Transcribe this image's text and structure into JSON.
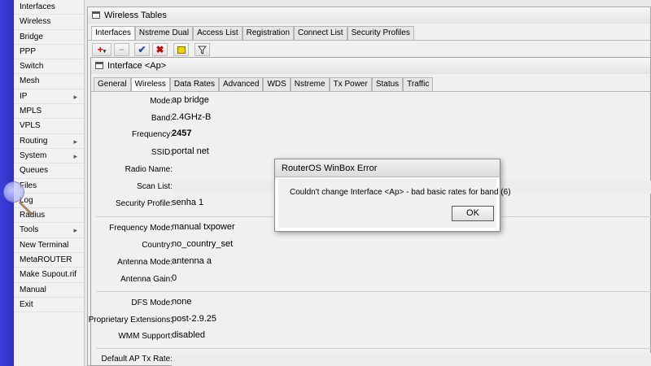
{
  "sidebar": {
    "items": [
      {
        "label": "Interfaces",
        "has_submenu": false
      },
      {
        "label": "Wireless",
        "has_submenu": false
      },
      {
        "label": "Bridge",
        "has_submenu": false
      },
      {
        "label": "PPP",
        "has_submenu": false
      },
      {
        "label": "Switch",
        "has_submenu": false
      },
      {
        "label": "Mesh",
        "has_submenu": false
      },
      {
        "label": "IP",
        "has_submenu": true
      },
      {
        "label": "MPLS",
        "has_submenu": false
      },
      {
        "label": "VPLS",
        "has_submenu": false
      },
      {
        "label": "Routing",
        "has_submenu": true
      },
      {
        "label": "System",
        "has_submenu": true
      },
      {
        "label": "Queues",
        "has_submenu": false
      },
      {
        "label": "Files",
        "has_submenu": false
      },
      {
        "label": "Log",
        "has_submenu": false
      },
      {
        "label": "Radius",
        "has_submenu": false
      },
      {
        "label": "Tools",
        "has_submenu": true
      },
      {
        "label": "New Terminal",
        "has_submenu": false
      },
      {
        "label": "MetaROUTER",
        "has_submenu": false
      },
      {
        "label": "Make Supout.rif",
        "has_submenu": false
      },
      {
        "label": "Manual",
        "has_submenu": false
      },
      {
        "label": "Exit",
        "has_submenu": false
      }
    ],
    "submenu_arrow": "▸"
  },
  "wireless_tables": {
    "title": "Wireless Tables",
    "tabs": [
      "Interfaces",
      "Nstreme Dual",
      "Access List",
      "Registration",
      "Connect List",
      "Security Profiles"
    ],
    "active_tab": "Interfaces",
    "toolbar": {
      "add": "+",
      "remove": "−",
      "enable": "✔",
      "disable": "✖",
      "comment": "",
      "filter": ""
    }
  },
  "interface_dialog": {
    "title": "Interface <Ap>",
    "tabs": [
      "General",
      "Wireless",
      "Data Rates",
      "Advanced",
      "WDS",
      "Nstreme",
      "Tx Power",
      "Status",
      "Traffic"
    ],
    "active_tab": "Wireless",
    "fields": {
      "mode": {
        "label": "Mode:",
        "value": "ap bridge"
      },
      "band": {
        "label": "Band:",
        "value": "2.4GHz-B"
      },
      "frequency": {
        "label": "Frequency:",
        "value": "2457"
      },
      "ssid": {
        "label": "SSID:",
        "value": "portal net"
      },
      "radio_name": {
        "label": "Radio Name:",
        "value": ""
      },
      "scan_list": {
        "label": "Scan List:",
        "value": ""
      },
      "security_profile": {
        "label": "Security Profile:",
        "value": "senha 1"
      },
      "frequency_mode": {
        "label": "Frequency Mode:",
        "value": "manual txpower"
      },
      "country": {
        "label": "Country:",
        "value": "no_country_set"
      },
      "antenna_mode": {
        "label": "Antenna Mode:",
        "value": "antenna a"
      },
      "antenna_gain": {
        "label": "Antenna Gain:",
        "value": "0"
      },
      "dfs_mode": {
        "label": "DFS Mode:",
        "value": "none"
      },
      "proprietary_extensions": {
        "label": "Proprietary Extensions:",
        "value": "post-2.9.25"
      },
      "wmm_support": {
        "label": "WMM Support:",
        "value": "disabled"
      },
      "default_ap_tx_rate": {
        "label": "Default AP Tx Rate:",
        "value": ""
      }
    }
  },
  "error_dialog": {
    "title": "RouterOS WinBox Error",
    "message": "Couldn't change Interface <Ap> - bad basic rates for band (6)",
    "ok_label": "OK"
  },
  "colors": {
    "brand_strip": "#2d2fc4",
    "add_button": "#cc0000",
    "enable_check": "#1f4fb8",
    "disable_x": "#cc0000",
    "comment_icon": "#f2d200"
  }
}
